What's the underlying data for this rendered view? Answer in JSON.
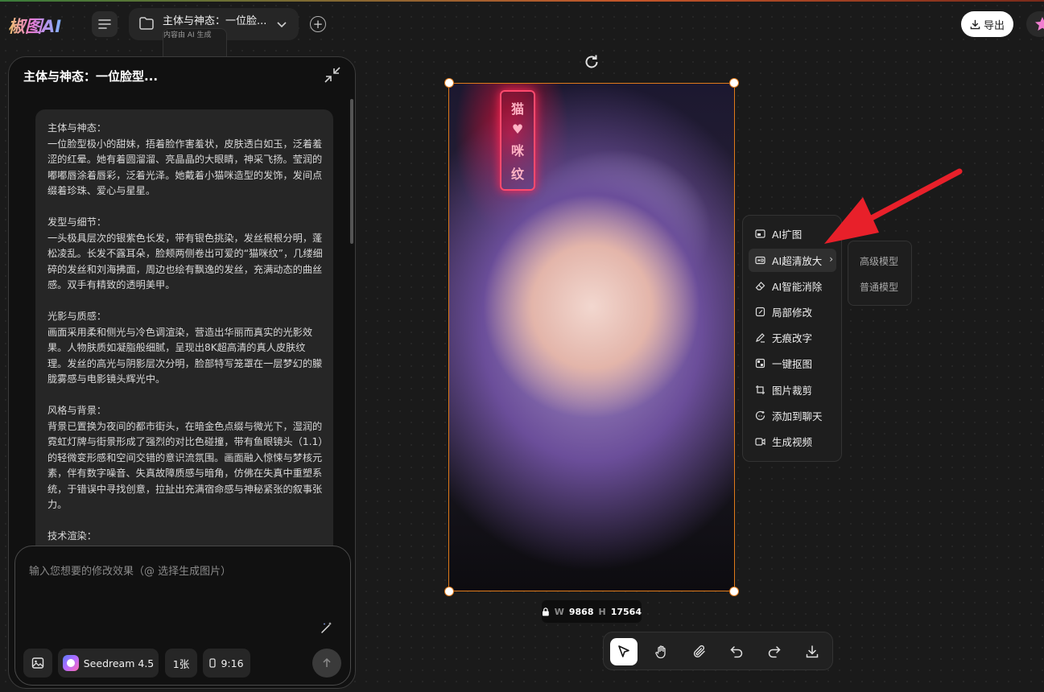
{
  "app": {
    "logo": "椒图AI"
  },
  "header": {
    "project_title": "主体与神态：一位脸...",
    "project_subtitle": "内容由 AI 生成",
    "export_label": "导出"
  },
  "chat": {
    "panel_title": "主体与神态：一位脸型...",
    "message": "主体与神态：\n一位脸型极小的甜妹，捂着脸作害羞状，皮肤透白如玉，泛着羞涩的红晕。她有着圆溜溜、亮晶晶的大眼睛，神采飞扬。莹润的嘟嘟唇涂着唇彩，泛着光泽。她戴着小猫咪造型的发饰，发间点缀着珍珠、爱心与星星。\n\n发型与细节：\n一头极具层次的银紫色长发，带有银色挑染，发丝根根分明，蓬松凌乱。长发不露耳朵，脸颊两侧卷出可爱的“猫咪纹”，几缕细碎的发丝和刘海拂面，周边也绘有飘逸的发丝，充满动态的曲丝感。双手有精致的透明美甲。\n\n光影与质感：\n画面采用柔和侧光与冷色调渲染，营造出华丽而真实的光影效果。人物肤质如凝脂般细腻，呈现出8K超高清的真人皮肤纹理。发丝的高光与阴影层次分明，脸部特写笼罩在一层梦幻的朦胧雾感与电影镜头辉光中。\n\n风格与背景：\n背景已置换为夜间的都市街头，在暗金色点缀与微光下，湿润的霓虹灯牌与街景形成了强烈的对比色碰撞，带有鱼眼镜头（1.1）的轻微变形感和空间交错的意识流氛围。画面融入惊悚与梦核元素，伴有数字噪音、失真故障质感与暗角，仿佛在失真中重塑系统，于错误中寻找创意，拉扯出充满宿命感与神秘紧张的叙事张力。\n\n技术渲染：",
    "input_placeholder": "输入您想要的修改效果（@ 选择生成图片）",
    "model_label": "Seedream 4.5",
    "count_label": "1张",
    "ratio_label": "9:16"
  },
  "canvas": {
    "neon_sign": [
      "猫",
      "♥",
      "咪",
      "纹"
    ],
    "width_key": "W",
    "width_value": "9868",
    "height_key": "H",
    "height_value": "17564"
  },
  "context_menu": {
    "items": [
      {
        "label": "AI扩图",
        "icon": "expand-icon"
      },
      {
        "label": "AI超清放大",
        "icon": "hd-icon",
        "active": true,
        "has_submenu": true
      },
      {
        "label": "AI智能消除",
        "icon": "eraser-icon"
      },
      {
        "label": "局部修改",
        "icon": "edit-region-icon"
      },
      {
        "label": "无痕改字",
        "icon": "pen-icon"
      },
      {
        "label": "一键抠图",
        "icon": "cutout-icon"
      },
      {
        "label": "图片裁剪",
        "icon": "crop-icon"
      },
      {
        "label": "添加到聊天",
        "icon": "chat-add-icon"
      },
      {
        "label": "生成视频",
        "icon": "video-icon"
      }
    ],
    "submenu": [
      "高级模型",
      "普通模型"
    ]
  },
  "toolbar": {
    "tools": [
      "select-tool",
      "hand-tool",
      "attach-tool",
      "undo-tool",
      "redo-tool",
      "download-tool"
    ]
  },
  "colors": {
    "selection": "#e07a1a",
    "annotation_arrow": "#e8202a",
    "background": "#1a1a1a"
  }
}
